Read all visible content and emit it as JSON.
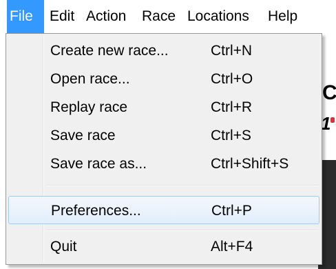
{
  "menubar": {
    "items": [
      {
        "label": "File",
        "active": true
      },
      {
        "label": "Edit"
      },
      {
        "label": "Action"
      },
      {
        "label": "Race"
      },
      {
        "label": "Locations"
      },
      {
        "label": "Help"
      }
    ]
  },
  "file_menu": {
    "items": [
      {
        "label": "Create new race...",
        "shortcut": "Ctrl+N"
      },
      {
        "label": "Open race...",
        "shortcut": "Ctrl+O"
      },
      {
        "label": "Replay race",
        "shortcut": "Ctrl+R"
      },
      {
        "label": "Save race",
        "shortcut": "Ctrl+S"
      },
      {
        "label": "Save race as...",
        "shortcut": "Ctrl+Shift+S"
      },
      {
        "label": "Preferences...",
        "shortcut": "Ctrl+P",
        "highlighted": true
      },
      {
        "label": "Quit",
        "shortcut": "Alt+F4"
      }
    ]
  },
  "background": {
    "heading_fragment": "C",
    "sub_fragment": "1"
  },
  "colors": {
    "menubar_active": "#3399ff",
    "menu_bg": "#f0f0f0",
    "highlight_border": "#a8c9ee"
  }
}
